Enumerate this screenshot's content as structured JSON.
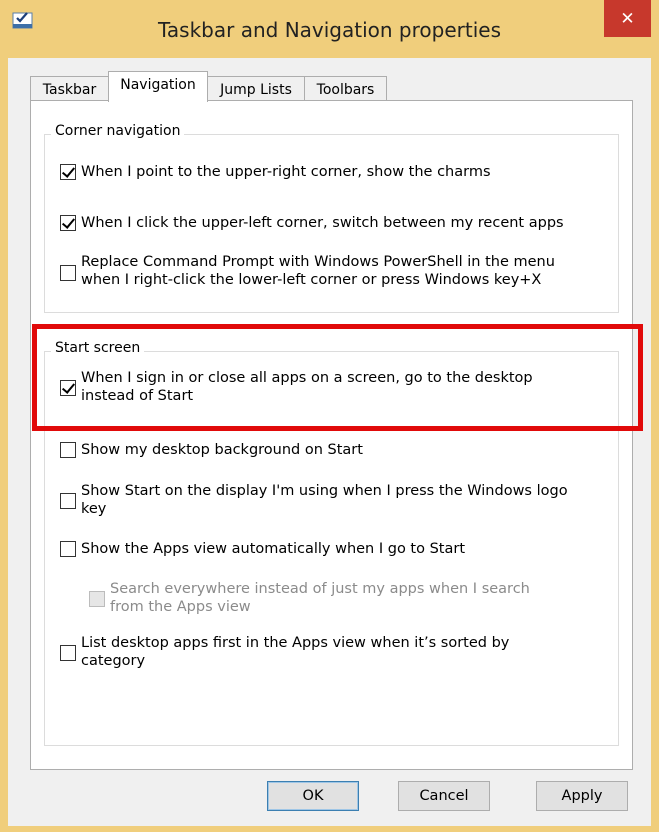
{
  "window": {
    "title": "Taskbar and Navigation properties",
    "close_symbol": "✕",
    "icon": "taskbar-properties-icon"
  },
  "tabs": [
    {
      "label": "Taskbar",
      "active": false
    },
    {
      "label": "Navigation",
      "active": true
    },
    {
      "label": "Jump Lists",
      "active": false
    },
    {
      "label": "Toolbars",
      "active": false
    }
  ],
  "corner": {
    "title": "Corner navigation",
    "items": [
      {
        "label": "When I point to the upper-right corner, show the charms",
        "checked": true
      },
      {
        "label": "When I click the upper-left corner, switch between my recent apps",
        "checked": true
      },
      {
        "label_line1": "Replace Command Prompt with Windows PowerShell in the menu",
        "label_line2": "when I right-click the lower-left corner or press Windows key+X",
        "checked": false
      }
    ]
  },
  "start": {
    "title": "Start screen",
    "items": [
      {
        "label_line1": "When I sign in or close all apps on a screen, go to the desktop",
        "label_line2": "instead of Start",
        "checked": true
      },
      {
        "label": "Show my desktop background on Start",
        "checked": false
      },
      {
        "label_line1": "Show Start on the display I'm using when I press the Windows logo",
        "label_line2": "key",
        "checked": false
      },
      {
        "label": "Show the Apps view automatically when I go to Start",
        "checked": false
      },
      {
        "label_line1": "Search everywhere instead of just my apps when I search",
        "label_line2": "from the Apps view",
        "checked": false,
        "disabled": true
      },
      {
        "label_line1": "List desktop apps first in the Apps view when it’s sorted by",
        "label_line2": "category",
        "checked": false
      }
    ]
  },
  "buttons": {
    "ok": "OK",
    "cancel": "Cancel",
    "apply": "Apply"
  },
  "colors": {
    "frame": "#f0ce7c",
    "close": "#c7382c",
    "highlight": "#e10a0a"
  }
}
